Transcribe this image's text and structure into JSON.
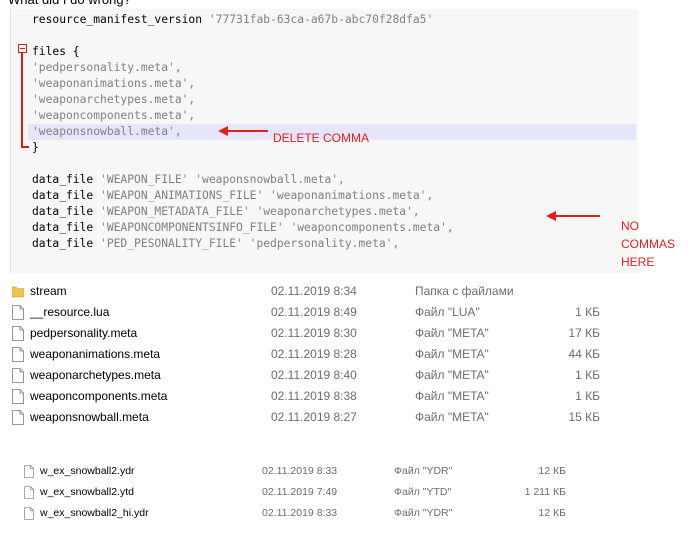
{
  "question": "What did I do wrong?",
  "code": {
    "lines": [
      [
        {
          "t": "resource_manifest_version ",
          "c": "kw"
        },
        {
          "t": "'77731fab-63ca-a67b-abc70f28dfa5'",
          "c": "str"
        }
      ],
      [],
      [
        {
          "t": "files {",
          "c": "kw"
        }
      ],
      [
        {
          "t": "'pedpersonality.meta',",
          "c": "str"
        }
      ],
      [
        {
          "t": "'weaponanimations.meta',",
          "c": "str"
        }
      ],
      [
        {
          "t": "'weaponarchetypes.meta',",
          "c": "str"
        }
      ],
      [
        {
          "t": "'weaponcomponents.meta',",
          "c": "str"
        }
      ],
      [
        {
          "t": "'weaponsnowball.meta',",
          "c": "str"
        }
      ],
      [
        {
          "t": "}",
          "c": "kw"
        }
      ],
      [],
      [
        {
          "t": "data_file ",
          "c": "kw"
        },
        {
          "t": "'WEAPON_FILE' 'weaponsnowball.meta',",
          "c": "str"
        }
      ],
      [
        {
          "t": "data_file ",
          "c": "kw"
        },
        {
          "t": "'WEAPON_ANIMATIONS_FILE' 'weaponanimations.meta',",
          "c": "str"
        }
      ],
      [
        {
          "t": "data_file ",
          "c": "kw"
        },
        {
          "t": "'WEAPON_METADATA_FILE' 'weaponarchetypes.meta',",
          "c": "str"
        }
      ],
      [
        {
          "t": "data_file ",
          "c": "kw"
        },
        {
          "t": "'WEAPONCOMPONENTSINFO_FILE' 'weaponcomponents.meta',",
          "c": "str"
        }
      ],
      [
        {
          "t": "data_file ",
          "c": "kw"
        },
        {
          "t": "'PED_PESONALITY_FILE' 'pedpersonality.meta',",
          "c": "str"
        }
      ]
    ]
  },
  "annotations": {
    "delete_comma": "DELETE COMMA",
    "no_commas_1": "NO",
    "no_commas_2": "COMMAS",
    "no_commas_3": "HERE"
  },
  "files": [
    {
      "name": "stream",
      "date": "02.11.2019 8:34",
      "type": "Папка с файлами",
      "size": "",
      "icon": "folder-icon"
    },
    {
      "name": "__resource.lua",
      "date": "02.11.2019 8:49",
      "type": "Файл \"LUA\"",
      "size": "1 КБ",
      "icon": "file-icon"
    },
    {
      "name": "pedpersonality.meta",
      "date": "02.11.2019 8:30",
      "type": "Файл \"META\"",
      "size": "17 КБ",
      "icon": "file-icon"
    },
    {
      "name": "weaponanimations.meta",
      "date": "02.11.2019 8:28",
      "type": "Файл \"META\"",
      "size": "44 КБ",
      "icon": "file-icon"
    },
    {
      "name": "weaponarchetypes.meta",
      "date": "02.11.2019 8:40",
      "type": "Файл \"META\"",
      "size": "1 КБ",
      "icon": "file-icon"
    },
    {
      "name": "weaponcomponents.meta",
      "date": "02.11.2019 8:38",
      "type": "Файл \"META\"",
      "size": "1 КБ",
      "icon": "file-icon"
    },
    {
      "name": "weaponsnowball.meta",
      "date": "02.11.2019 8:27",
      "type": "Файл \"META\"",
      "size": "15 КБ",
      "icon": "file-icon"
    }
  ],
  "stream_files": [
    {
      "name": "w_ex_snowball2.ydr",
      "date": "02.11.2019 8:33",
      "type": "Файл \"YDR\"",
      "size": "12 КБ",
      "icon": "file-icon"
    },
    {
      "name": "w_ex_snowball2.ytd",
      "date": "02.11.2019 7:49",
      "type": "Файл \"YTD\"",
      "size": "1 211 КБ",
      "icon": "file-icon"
    },
    {
      "name": "w_ex_snowball2_hi.ydr",
      "date": "02.11.2019 8:33",
      "type": "Файл \"YDR\"",
      "size": "12 КБ",
      "icon": "file-icon"
    }
  ],
  "colors": {
    "annotation": "#e0201c",
    "highlight": "#e6e6fa",
    "folder": "#f0c24e"
  }
}
